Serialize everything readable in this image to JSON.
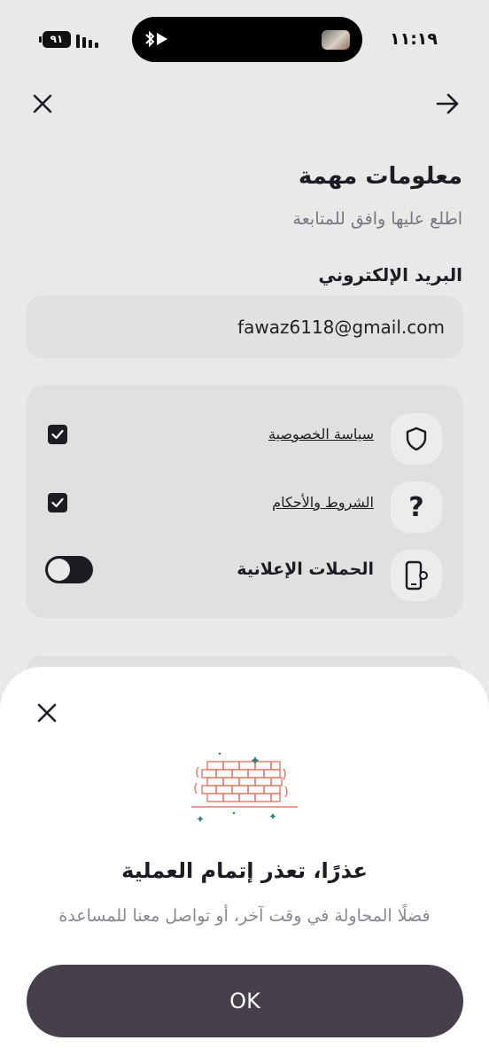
{
  "status_bar": {
    "time": "١١:١٩",
    "battery": "٩١",
    "icons": [
      "battery-icon",
      "signal-icon",
      "bluetooth-icon",
      "play-icon"
    ]
  },
  "header": {
    "close_icon": "close-icon",
    "next_icon": "arrow-right-icon"
  },
  "page": {
    "title": "معلومات مهمة",
    "subtitle": "اطلع عليها وافق للمتابعة",
    "email_label": "البريد الإلكتروني",
    "email_value": "fawaz6118@gmail.com"
  },
  "consents": [
    {
      "label": "سياسة الخصوصية",
      "icon": "shield-icon",
      "control": "checkbox",
      "checked": true
    },
    {
      "label": "الشروط والأحكام",
      "icon": "question-mark-icon",
      "control": "checkbox",
      "checked": true
    },
    {
      "label": "الحملات الإعلانية",
      "icon": "phone-settings-icon",
      "control": "toggle",
      "checked": false
    }
  ],
  "sheet": {
    "title": "عذرًا، تعذر إتمام العملية",
    "message": "فضلًا المحاولة في وقت آخر، أو تواصل معنا للمساعدة",
    "ok_label": "OK",
    "illustration": "brick-wall-illustration"
  },
  "colors": {
    "background": "#e9e9e9",
    "primary": "#1f1b22",
    "button": "#45404b",
    "brick": "#e07a6a",
    "sparkle": "#2f7d74"
  }
}
